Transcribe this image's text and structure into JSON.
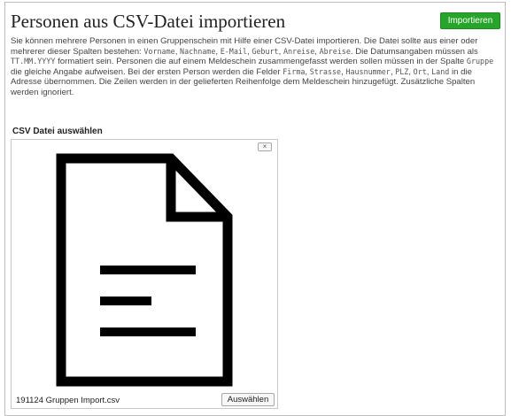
{
  "header": {
    "title": "Personen aus CSV-Datei importieren",
    "import_button": "Importieren"
  },
  "description": {
    "t1": "Sie können mehrere Personen in einen Gruppenschein mit Hilfe einer CSV-Datei importieren. Die Datei sollte aus einer oder mehrerer dieser Spalten bestehen: ",
    "c_vorname": "Vorname",
    "sep1": ", ",
    "c_nachname": "Nachname",
    "sep2": ", ",
    "c_email": "E-Mail",
    "sep3": ", ",
    "c_geburt": "Geburt",
    "sep4": ", ",
    "c_anreise": "Anreise",
    "sep5": ", ",
    "c_abreise": "Abreise",
    "t2": ". Die Datumsangaben müssen als ",
    "c_date": "TT.MM.YYYY",
    "t3": " formatiert sein. Personen die auf einem Meldeschein zusammengefasst werden sollen müssen in der Spalte ",
    "c_gruppe": "Gruppe",
    "t4": " die gleiche Angabe aufweisen. Bei der ersten Person werden die Felder ",
    "c_firma": "Firma",
    "sep6": ", ",
    "c_strasse": "Strasse",
    "sep7": ", ",
    "c_hausnummer": "Hausnummer",
    "sep8": ", ",
    "c_plz": "PLZ",
    "sep9": ", ",
    "c_ort": "Ort",
    "sep10": ", ",
    "c_land": "Land",
    "t5": " in die Adresse übernommen. Die Zeilen werden in der gelieferten Reihenfolge dem Meldeschein hinzugefügt. Zusätzliche Spalten werden ignoriert."
  },
  "file_section": {
    "label": "CSV Datei auswählen",
    "close_label": "×",
    "filename": "191124 Gruppen Import.csv",
    "choose_button": "Auswählen",
    "icon": "document-icon"
  }
}
